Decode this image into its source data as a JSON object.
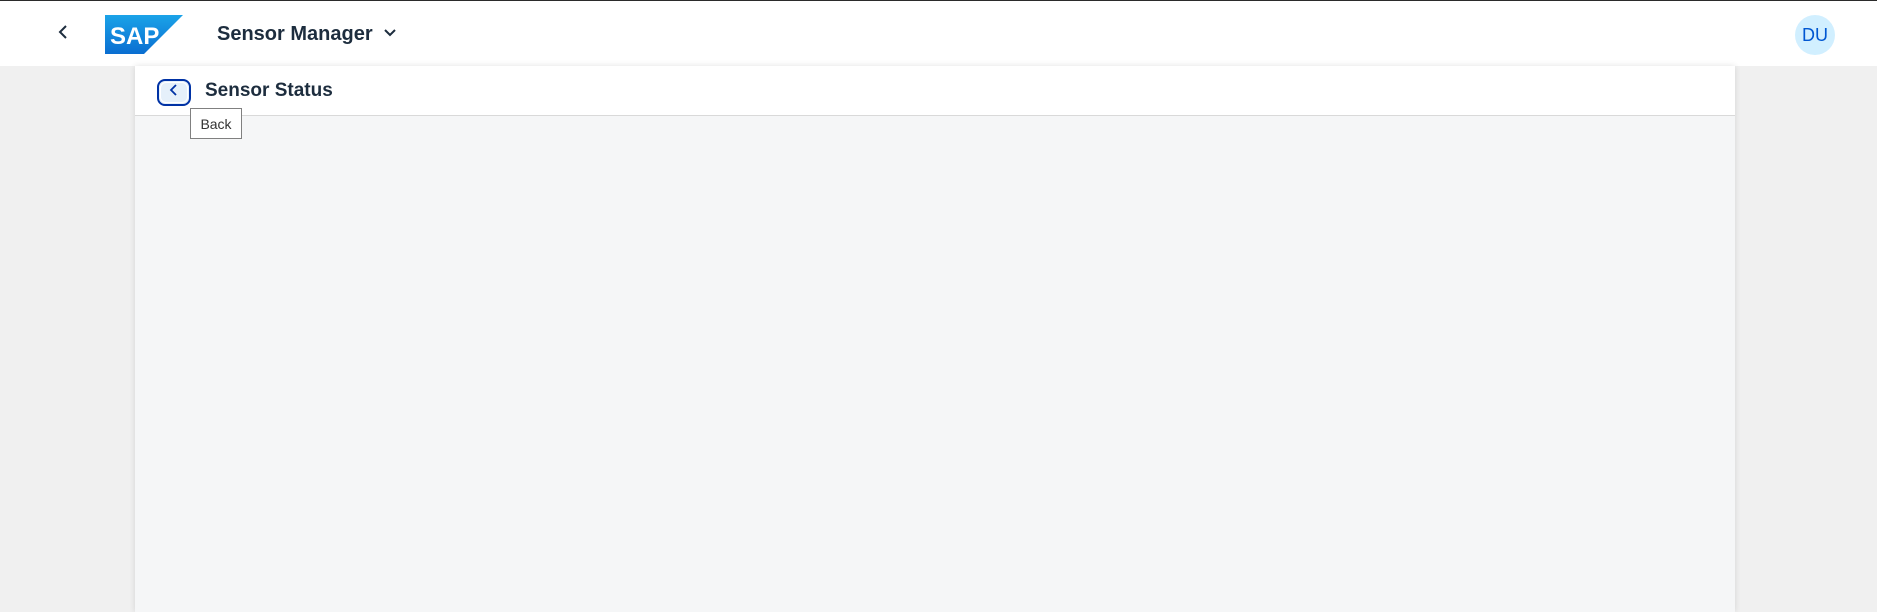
{
  "shell": {
    "back_icon": "chevron-left-icon",
    "logo": {
      "text": "SAP",
      "colors": [
        "#0a6ed1",
        "#1ba3e8"
      ]
    },
    "app_title": "Sensor Manager",
    "app_title_icon": "chevron-down-icon",
    "avatar_initials": "DU"
  },
  "page": {
    "back_icon": "chevron-left-icon",
    "title": "Sensor Status"
  },
  "tooltip": {
    "text": "Back"
  },
  "colors": {
    "accent": "#0032a5",
    "avatar_bg": "#d1efff",
    "avatar_text": "#0057d2",
    "content_bg": "#f5f6f7",
    "outer_bg": "#f0f0f0"
  }
}
